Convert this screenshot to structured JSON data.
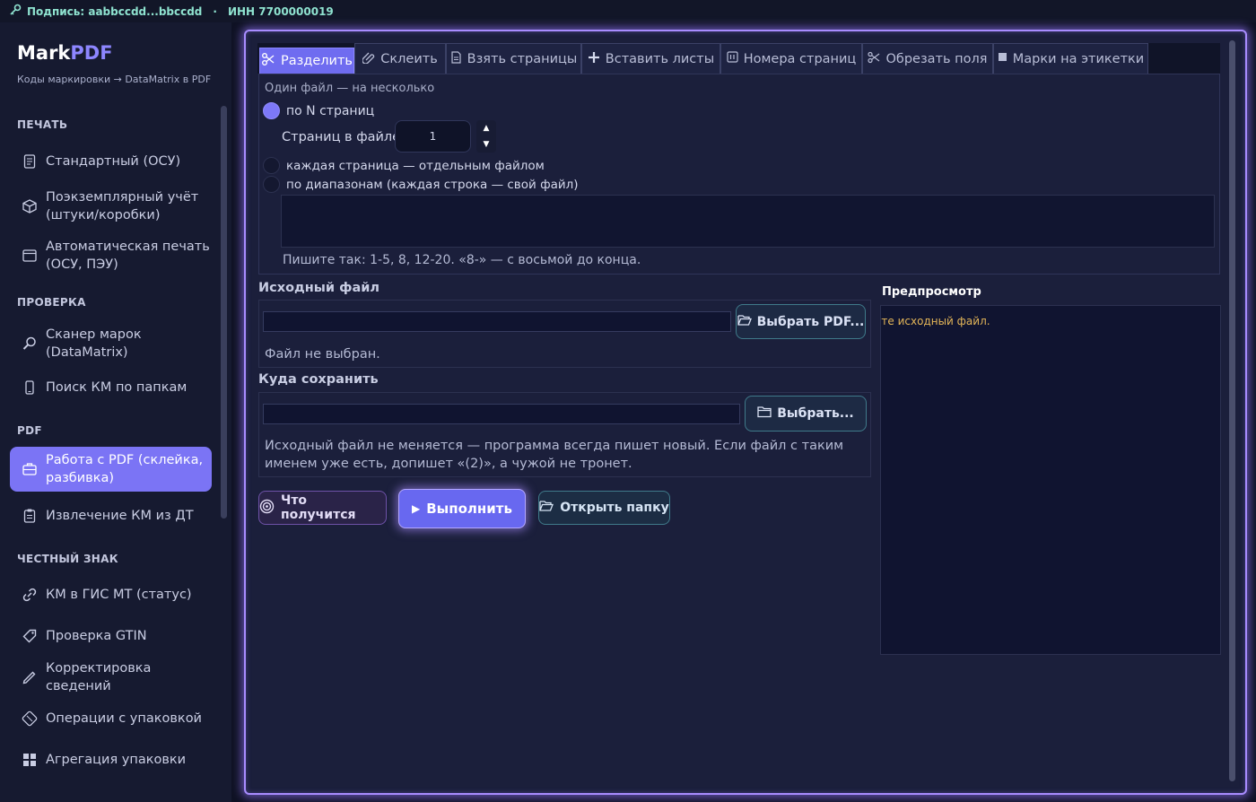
{
  "topbar": {
    "signature": "Подпись: aabbccdd...bbccdd",
    "separator": "·",
    "inn": "ИНН 7700000019"
  },
  "sidebar": {
    "brand_main": "Mark",
    "brand_accent": "PDF",
    "subtitle": "Коды маркировки → DataMatrix в PDF",
    "sections": {
      "print": "ПЕЧАТЬ",
      "check": "ПРОВЕРКА",
      "pdf": "PDF",
      "cz": "ЧЕСТНЫЙ ЗНАК"
    },
    "items": [
      {
        "label": "Стандартный (ОСУ)",
        "icon": "document-icon"
      },
      {
        "label": "Поэкземплярный учёт (штуки/коробки)",
        "icon": "box-icon"
      },
      {
        "label": "Автоматическая печать (ОСУ, ПЭУ)",
        "icon": "window-icon"
      },
      {
        "label": "Сканер марок (DataMatrix)",
        "icon": "magnifier-icon"
      },
      {
        "label": "Поиск КМ по папкам",
        "icon": "phone-icon"
      },
      {
        "label": "Работа с PDF (склейка, разбивка)",
        "icon": "briefcase-icon"
      },
      {
        "label": "Извлечение КМ из ДТ",
        "icon": "clipboard-icon"
      },
      {
        "label": "КМ в ГИС МТ (статус)",
        "icon": "link-icon"
      },
      {
        "label": "Проверка GTIN",
        "icon": "tag-icon"
      },
      {
        "label": "Корректировка сведений",
        "icon": "pencil-icon"
      },
      {
        "label": "Операции с упаковкой",
        "icon": "package-icon"
      },
      {
        "label": "Агрегация упаковки",
        "icon": "grid-icon"
      }
    ]
  },
  "tabs": [
    {
      "label": "Разделить",
      "icon": "scissors-icon"
    },
    {
      "label": "Склеить",
      "icon": "paperclip-icon"
    },
    {
      "label": "Взять страницы",
      "icon": "page-icon"
    },
    {
      "label": "Вставить листы",
      "icon": "plus-icon"
    },
    {
      "label": "Номера страниц",
      "icon": "numbers-icon"
    },
    {
      "label": "Обрезать поля",
      "icon": "crop-icon"
    },
    {
      "label": "Марки на этикетки",
      "icon": "square-icon"
    }
  ],
  "split": {
    "legend": "Один файл — на несколько",
    "opt_n": "по N страниц",
    "pages_label": "Страниц в файле:",
    "pages_value": "1",
    "spin_up": "▲",
    "spin_down": "▼",
    "opt_each": "каждая страница — отдельным файлом",
    "opt_ranges": "по диапазонам (каждая строка — свой файл)",
    "ranges_value": "",
    "hint": "Пишите так: 1-5, 8, 12-20. «8-» — с восьмой до конца."
  },
  "source": {
    "title": "Исходный файл",
    "path": "",
    "button": "Выбрать PDF...",
    "status": "Файл не выбран."
  },
  "target": {
    "title": "Куда сохранить",
    "path": "",
    "button": "Выбрать...",
    "note": "Исходный файл не меняется — программа всегда пишет новый. Если файл с таким именем уже есть, допишет «(2)», а чужой не тронет."
  },
  "preview": {
    "title": "Предпросмотр",
    "message": "рите исходный файл."
  },
  "actions": {
    "preview_btn": "Что получится",
    "run_btn": "Выполнить",
    "run_icon": "▶",
    "open_btn": "Открыть папку"
  },
  "colors": {
    "accent": "#7b74f5",
    "frame_glow": "#a88cff",
    "topbar_text": "#8fe3d0",
    "warning_text": "#e3b558"
  }
}
